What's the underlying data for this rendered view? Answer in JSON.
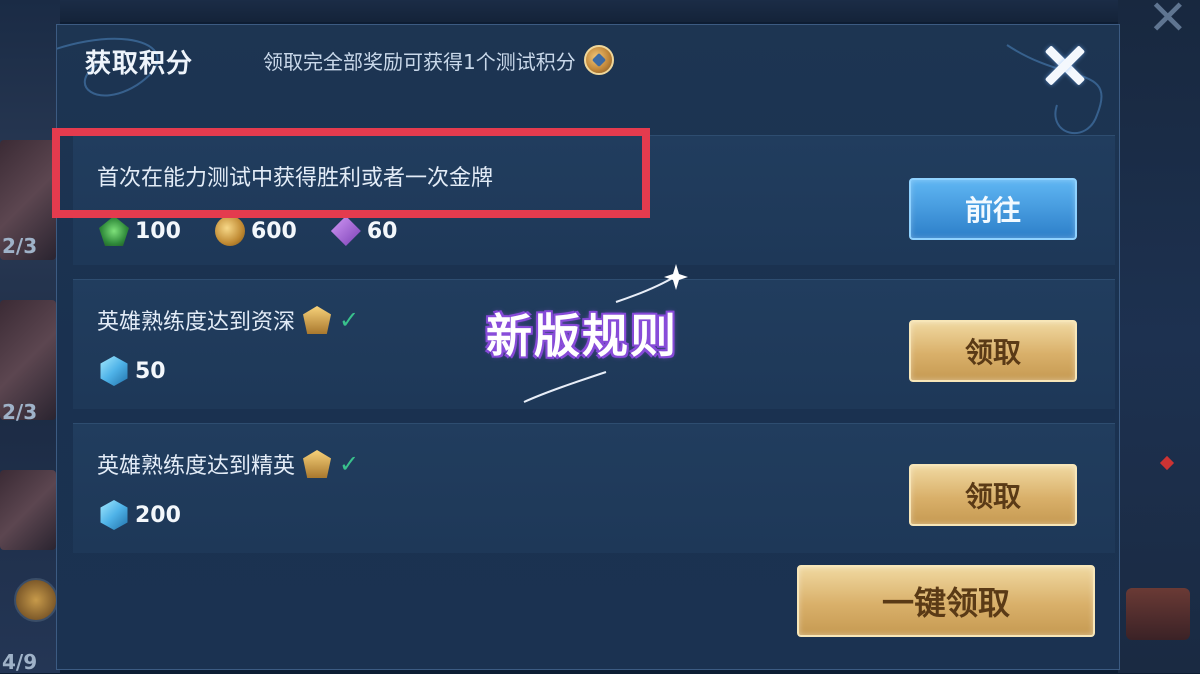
{
  "background": {
    "left_fractions": [
      "2/3",
      "2/3",
      "4/9"
    ]
  },
  "modal": {
    "title": "获取积分",
    "subtitle": "领取完全部奖励可获得1个测试积分",
    "close_icon": "close-icon"
  },
  "tasks": [
    {
      "description": "首次在能力测试中获得胜利或者一次金牌",
      "rewards": [
        {
          "icon": "green-gem-icon",
          "amount": "100"
        },
        {
          "icon": "gold-coin-icon",
          "amount": "600"
        },
        {
          "icon": "purple-crystal-icon",
          "amount": "60"
        }
      ],
      "button_label": "前往"
    },
    {
      "description": "英雄熟练度达到资深",
      "rewards": [
        {
          "icon": "blue-crystal-icon",
          "amount": "50"
        }
      ],
      "button_label": "领取"
    },
    {
      "description": "英雄熟练度达到精英",
      "rewards": [
        {
          "icon": "blue-crystal-icon",
          "amount": "200"
        }
      ],
      "button_label": "领取"
    }
  ],
  "claim_all_label": "一键领取",
  "overlay_title": "新版规则",
  "colors": {
    "highlight": "#e43b4e",
    "gold_button": "#d9b06a",
    "blue_button": "#2d7fc9",
    "panel": "#1d3552"
  }
}
